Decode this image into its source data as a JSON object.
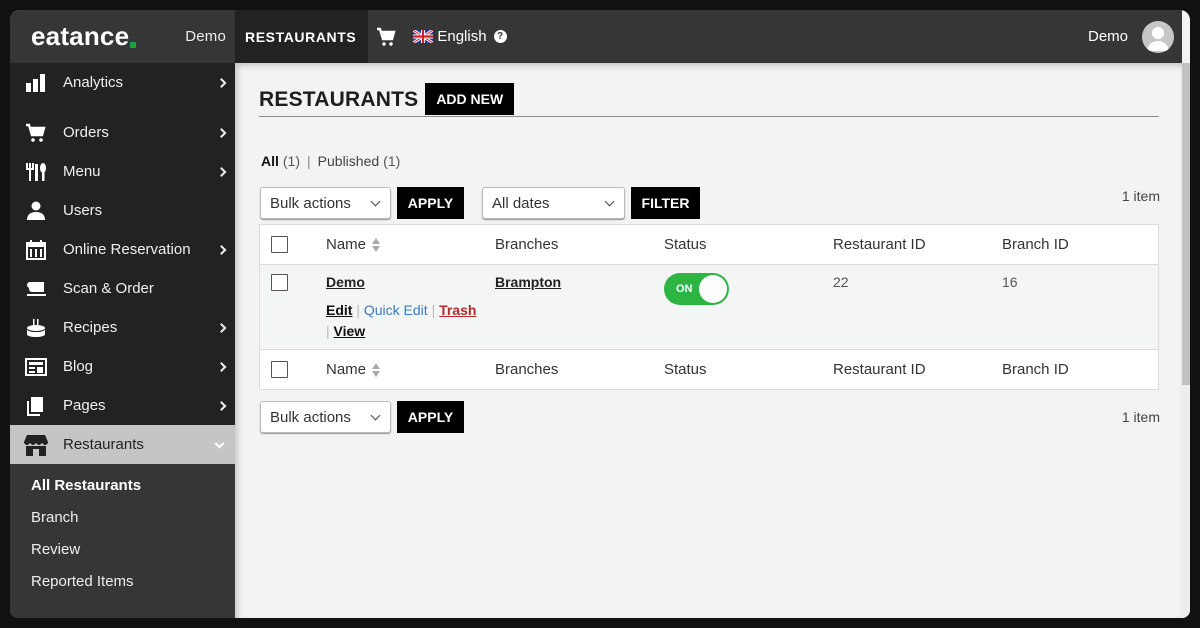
{
  "topbar": {
    "logo": "eatance",
    "site_name": "Demo",
    "active_section": "RESTAURANTS",
    "cart_icon": "cart-icon",
    "language": "English",
    "language_flag": "uk-flag-icon",
    "help_icon": "help-icon",
    "user_name": "Demo",
    "avatar_icon": "user-avatar-icon"
  },
  "sidebar": {
    "items": [
      {
        "label": "Analytics",
        "icon": "bar-chart-icon",
        "has_submenu": true
      },
      {
        "label": "Orders",
        "icon": "cart-icon",
        "has_submenu": true
      },
      {
        "label": "Menu",
        "icon": "utensils-icon",
        "has_submenu": true
      },
      {
        "label": "Users",
        "icon": "user-icon",
        "has_submenu": false
      },
      {
        "label": "Online Reservation",
        "icon": "calendar-icon",
        "has_submenu": true
      },
      {
        "label": "Scan & Order",
        "icon": "scan-order-icon",
        "has_submenu": false
      },
      {
        "label": "Recipes",
        "icon": "cake-icon",
        "has_submenu": true
      },
      {
        "label": "Blog",
        "icon": "newspaper-icon",
        "has_submenu": true
      },
      {
        "label": "Pages",
        "icon": "pages-icon",
        "has_submenu": true
      },
      {
        "label": "Restaurants",
        "icon": "store-icon",
        "has_submenu": true,
        "expanded": true
      }
    ],
    "submenu": [
      {
        "label": "All Restaurants",
        "current": true
      },
      {
        "label": "Branch"
      },
      {
        "label": "Review"
      },
      {
        "label": "Reported Items"
      }
    ]
  },
  "main": {
    "title": "RESTAURANTS",
    "add_new_label": "ADD NEW",
    "views": {
      "all_label": "All",
      "all_count": "(1)",
      "separator": "|",
      "published_label": "Published",
      "published_count": "(1)"
    },
    "top_nav": {
      "bulk_actions": "Bulk actions",
      "apply_label": "APPLY",
      "dates": "All dates",
      "filter_label": "FILTER",
      "item_count": "1 item"
    },
    "bottom_nav": {
      "bulk_actions": "Bulk actions",
      "apply_label": "APPLY",
      "item_count": "1 item"
    },
    "table": {
      "columns": [
        "Name",
        "Branches",
        "Status",
        "Restaurant ID",
        "Branch ID"
      ],
      "rows": [
        {
          "name": "Demo",
          "branches": "Brampton",
          "status": "ON",
          "status_on": true,
          "restaurant_id": "22",
          "branch_id": "16",
          "actions": {
            "edit": "Edit",
            "quick_edit": "Quick Edit",
            "trash": "Trash",
            "view": "View",
            "sep": "|"
          }
        }
      ]
    }
  }
}
